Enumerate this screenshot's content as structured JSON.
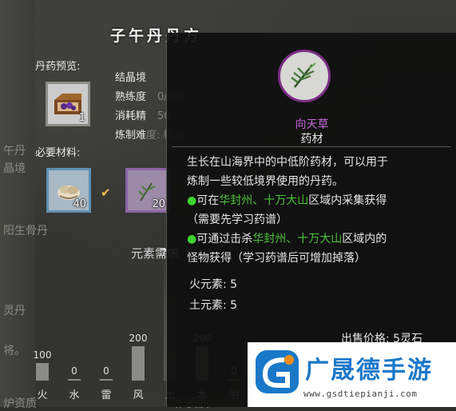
{
  "title": "子午丹丹方",
  "preview_label": "丹药预览:",
  "materials_label": "必要材料:",
  "preview_item": {
    "count": "1"
  },
  "stats": {
    "realm_label": "结晶境",
    "proficiency_label": "熟练度",
    "proficiency_value": "0/100",
    "consume_label": "消耗精",
    "consume_value": "50",
    "difficulty_label": "炼制难",
    "difficulty_value": "度: 极易"
  },
  "materials": [
    {
      "count": "40"
    },
    {
      "count": "20"
    }
  ],
  "ghost_texts": {
    "left1": "午丹",
    "left2": "晶境",
    "left3": "阳生骨丹",
    "left4": "灵丹",
    "left5": "将。",
    "left6": "炉资质",
    "bottom": "炉资质",
    "element_req": "元素需求"
  },
  "elements": [
    {
      "name": "火",
      "value": "100",
      "level": 0.43
    },
    {
      "name": "水",
      "value": "0",
      "level": 0.0
    },
    {
      "name": "雷",
      "value": "0",
      "level": 0.0
    },
    {
      "name": "风",
      "value": "200",
      "level": 0.86
    },
    {
      "name": "土",
      "value": "700",
      "level": 3.0
    },
    {
      "name": "木",
      "value": "200",
      "level": 0.86
    },
    {
      "name": "阴",
      "value": "0",
      "level": 0.0
    }
  ],
  "tooltip": {
    "name": "向天草",
    "type": "药材",
    "desc_line1": "生长在山海界中的中低阶药材，可以用于",
    "desc_line2": "炼制一些较低境界使用的丹药。",
    "loc1_prefix": "可在",
    "loc1_place": "华封州、十万大山",
    "loc1_suffix": "区域内采集获得",
    "loc1_note": "（需要先学习药谱）",
    "loc2_prefix": "可通过击杀",
    "loc2_place": "华封州、十万大山",
    "loc2_suffix": "区域内的",
    "loc2_line2": "怪物获得（学习药谱后可增加掉落）",
    "fire_elem": "火元素: 5",
    "earth_elem": "土元素: 5",
    "price": "出售价格: 5灵石"
  },
  "watermark": {
    "title": "广晟德手游",
    "url": "www.gsdtiepianji.com"
  },
  "colors": {
    "herb_name": "#c066d6",
    "place_green": "#4ec23b",
    "rare_border": "#7b2f85",
    "brand_blue": "#1a78c8"
  }
}
